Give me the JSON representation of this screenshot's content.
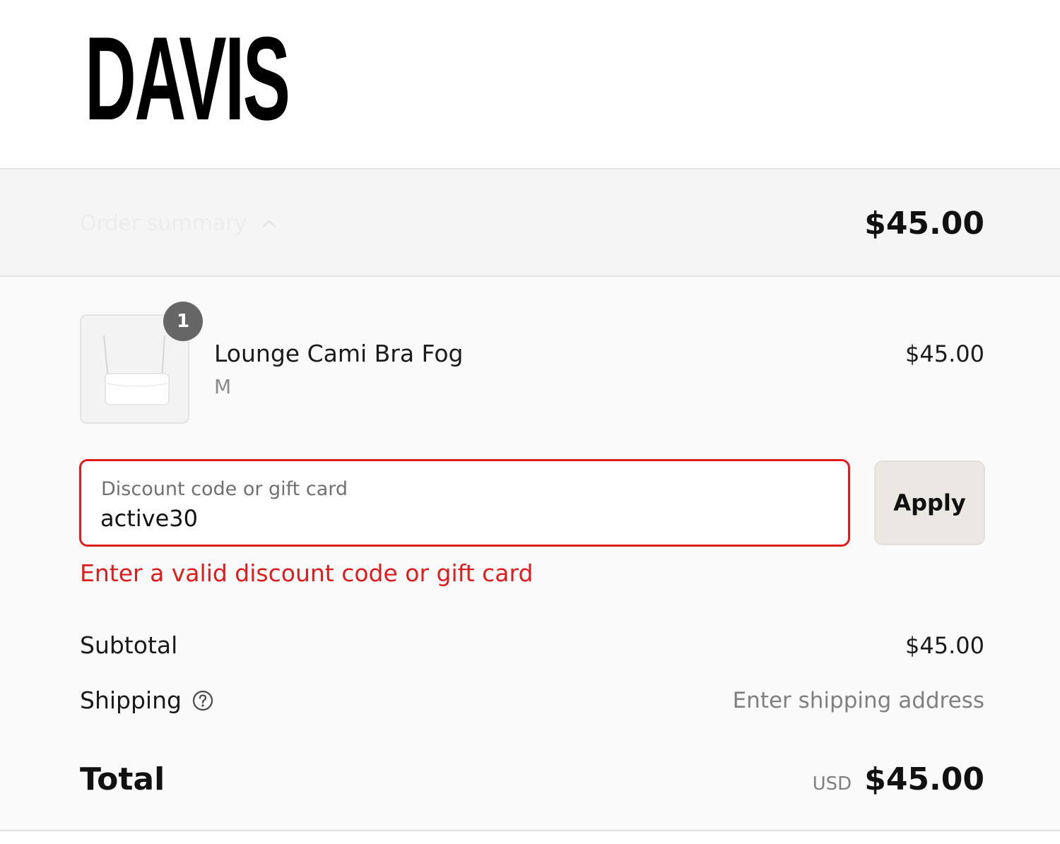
{
  "brand": {
    "logo_text": "DAVIS"
  },
  "summary_bar": {
    "toggle_label": "Order summary",
    "toggle_icon": "chevron-up-icon",
    "total": "$45.00"
  },
  "cart": {
    "items": [
      {
        "name": "Lounge Cami Bra Fog",
        "variant": "M",
        "quantity": "1",
        "price": "$45.00",
        "image": "product-thumbnail"
      }
    ]
  },
  "discount": {
    "label": "Discount code or gift card",
    "value": "active30",
    "apply_label": "Apply",
    "error": "Enter a valid discount code or gift card",
    "error_color": "#dd1d1d"
  },
  "totals": {
    "subtotal_label": "Subtotal",
    "subtotal_value": "$45.00",
    "shipping_label": "Shipping",
    "shipping_help_icon": "question-circle-icon",
    "shipping_value": "Enter shipping address",
    "total_label": "Total",
    "currency": "USD",
    "total_value": "$45.00"
  }
}
